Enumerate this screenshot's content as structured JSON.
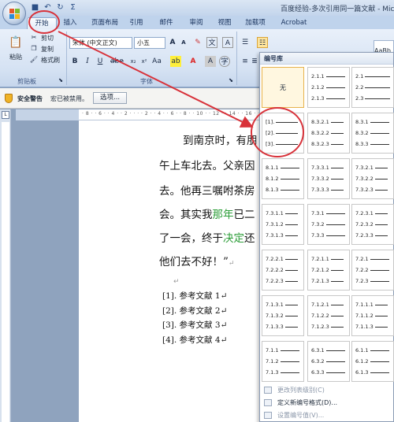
{
  "window": {
    "title": "百度经验-多次引用同一篇文献 - Mic",
    "qat_icons": [
      "save-icon",
      "undo-icon",
      "redo-icon",
      "sigma-icon"
    ]
  },
  "tabs": [
    "开始",
    "插入",
    "页面布局",
    "引用",
    "邮件",
    "审阅",
    "视图",
    "加载项",
    "Acrobat"
  ],
  "ribbon": {
    "clipboard": {
      "paste": "粘贴",
      "cut": "剪切",
      "copy": "复制",
      "format_painter": "格式刷",
      "group_label": "剪贴板"
    },
    "font": {
      "font_name": "宋体 (中文正文)",
      "font_size": "小五",
      "group_label": "字体"
    },
    "styles": {
      "preview": "AaBb"
    }
  },
  "security_bar": {
    "title": "安全警告",
    "message": "宏已被禁用。",
    "options_button": "选项..."
  },
  "document": {
    "lines": [
      {
        "parts": [
          {
            "t": "到南京时，有朋"
          }
        ]
      },
      {
        "parts": [
          {
            "t": "午上车北去。父亲因"
          }
        ]
      },
      {
        "parts": [
          {
            "t": "去。他再三嘱咐茶房"
          }
        ]
      },
      {
        "parts": [
          {
            "t": "会。其实我"
          },
          {
            "t": "那年",
            "g": true
          },
          {
            "t": "已二"
          }
        ]
      },
      {
        "parts": [
          {
            "t": "了一会，终于"
          },
          {
            "t": "决定",
            "g": true
          },
          {
            "t": "还"
          }
        ]
      },
      {
        "parts": [
          {
            "t": "他们去不好！”"
          },
          {
            "t": "↵",
            "m": true
          }
        ]
      }
    ],
    "blank_mark": "↵",
    "references": [
      "[1]. 参考文献 1↵",
      "[2]. 参考文献 2↵",
      "[3]. 参考文献 3↵",
      "[4]. 参考文献 4↵"
    ]
  },
  "numbering_library": {
    "header": "编号库",
    "none_label": "无",
    "cells": [
      [
        "无"
      ],
      [
        "2.1.1",
        "2.1.2",
        "2.1.3"
      ],
      [
        "2.1",
        "2.2",
        "2.3"
      ],
      [
        "[1].",
        "[2].",
        "[3]."
      ],
      [
        "8.3.2.1",
        "8.3.2.2",
        "8.3.2.3"
      ],
      [
        "8.3.1",
        "8.3.2",
        "8.3.3"
      ],
      [
        "8.1.1",
        "8.1.2",
        "8.1.3"
      ],
      [
        "7.3.3.1",
        "7.3.3.2",
        "7.3.3.3"
      ],
      [
        "7.3.2.1",
        "7.3.2.2",
        "7.3.2.3"
      ],
      [
        "7.3.1.1",
        "7.3.1.2",
        "7.3.1.3"
      ],
      [
        "7.3.1",
        "7.3.2",
        "7.3.3"
      ],
      [
        "7.2.3.1",
        "7.2.3.2",
        "7.2.3.3"
      ],
      [
        "7.2.2.1",
        "7.2.2.2",
        "7.2.2.3"
      ],
      [
        "7.2.1.1",
        "7.2.1.2",
        "7.2.1.3"
      ],
      [
        "7.2.1",
        "7.2.2",
        "7.2.3"
      ],
      [
        "7.1.3.1",
        "7.1.3.2",
        "7.1.3.3"
      ],
      [
        "7.1.2.1",
        "7.1.2.2",
        "7.1.2.3"
      ],
      [
        "7.1.1.1",
        "7.1.1.2",
        "7.1.1.3"
      ],
      [
        "7.1.1",
        "7.1.2",
        "7.1.3"
      ],
      [
        "6.3.1",
        "6.3.2",
        "6.3.3"
      ],
      [
        "6.1.1",
        "6.1.2",
        "6.1.3"
      ]
    ],
    "footer": {
      "change_level": "更改列表级别(C)",
      "define_new": "定义新编号格式(D)...",
      "set_value": "设置编号值(V)..."
    }
  },
  "colors": {
    "annotation_red": "#d8323a",
    "ribbon_blue": "#d5e2f3",
    "highlight_green": "#2e9e3a"
  }
}
